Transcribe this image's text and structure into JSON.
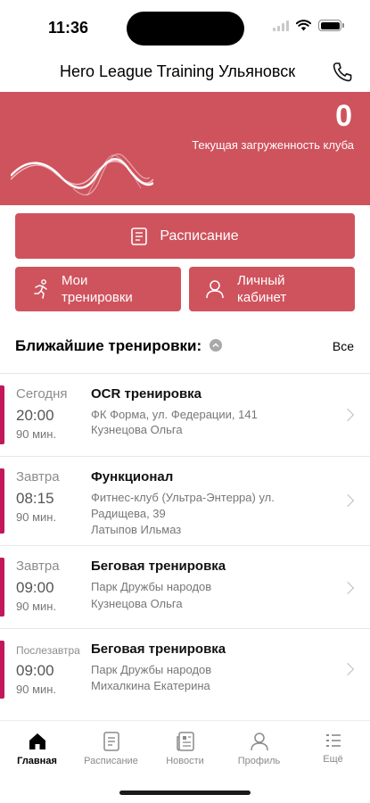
{
  "status_bar": {
    "time": "11:36"
  },
  "header": {
    "title": "Hero League Training  Ульяновск"
  },
  "banner": {
    "value": "0",
    "label": "Текущая загруженность клуба",
    "color": "#cf535d"
  },
  "actions": {
    "schedule": "Расписание",
    "my_workouts": "Мои тренировки",
    "cabinet": "Личный кабинет"
  },
  "section": {
    "title": "Ближайшие тренировки:",
    "all": "Все"
  },
  "trainings": [
    {
      "day": "Сегодня",
      "time": "20:00",
      "duration": "90 мин.",
      "title": "OCR тренировка",
      "place": "ФК Форма, ул. Федерации, 141",
      "coach": "Кузнецова Ольга"
    },
    {
      "day": "Завтра",
      "time": "08:15",
      "duration": "90 мин.",
      "title": "Функционал",
      "place": "Фитнес-клуб (Ультра-Энтерра) ул. Радищева, 39",
      "coach": "Латыпов Ильмаз"
    },
    {
      "day": "Завтра",
      "time": "09:00",
      "duration": "90 мин.",
      "title": "Беговая тренировка",
      "place": "Парк Дружбы народов",
      "coach": "Кузнецова Ольга"
    },
    {
      "day": "Послезавтра",
      "time": "09:00",
      "duration": "90 мин.",
      "title": "Беговая тренировка",
      "place": "Парк Дружбы народов",
      "coach": "Михалкина Екатерина"
    }
  ],
  "tabbar": {
    "items": [
      {
        "label": "Главная",
        "icon": "home-icon",
        "active": true
      },
      {
        "label": "Расписание",
        "icon": "schedule-icon",
        "active": false
      },
      {
        "label": "Новости",
        "icon": "news-icon",
        "active": false
      },
      {
        "label": "Профиль",
        "icon": "profile-icon",
        "active": false
      },
      {
        "label": "Ещё",
        "icon": "more-icon",
        "active": false
      }
    ]
  },
  "colors": {
    "accent": "#cf535d",
    "marker": "#c2185b"
  }
}
